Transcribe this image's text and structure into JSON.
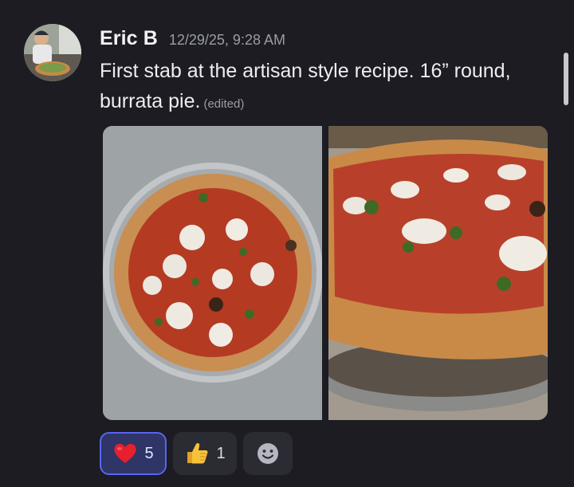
{
  "message": {
    "author": "Eric B",
    "timestamp": "12/29/25, 9:28 AM",
    "text": "First stab at the artisan style recipe. 16” round, burrata pie.",
    "edited_label": "(edited)"
  },
  "attachments": [
    {
      "name": "pizza-photo-top-view"
    },
    {
      "name": "pizza-photo-angled-view"
    }
  ],
  "reactions": [
    {
      "emoji": "heart",
      "count": "5",
      "active": true
    },
    {
      "emoji": "thumbs-up",
      "count": "1",
      "active": false
    },
    {
      "emoji": "add-reaction-smiley",
      "count": "",
      "active": false
    }
  ],
  "colors": {
    "background": "#1c1c22",
    "reaction_active_bg": "#2f3566",
    "reaction_active_border": "#5865f2",
    "reaction_bg": "#2b2c33",
    "muted_text": "#9a9ca6"
  }
}
